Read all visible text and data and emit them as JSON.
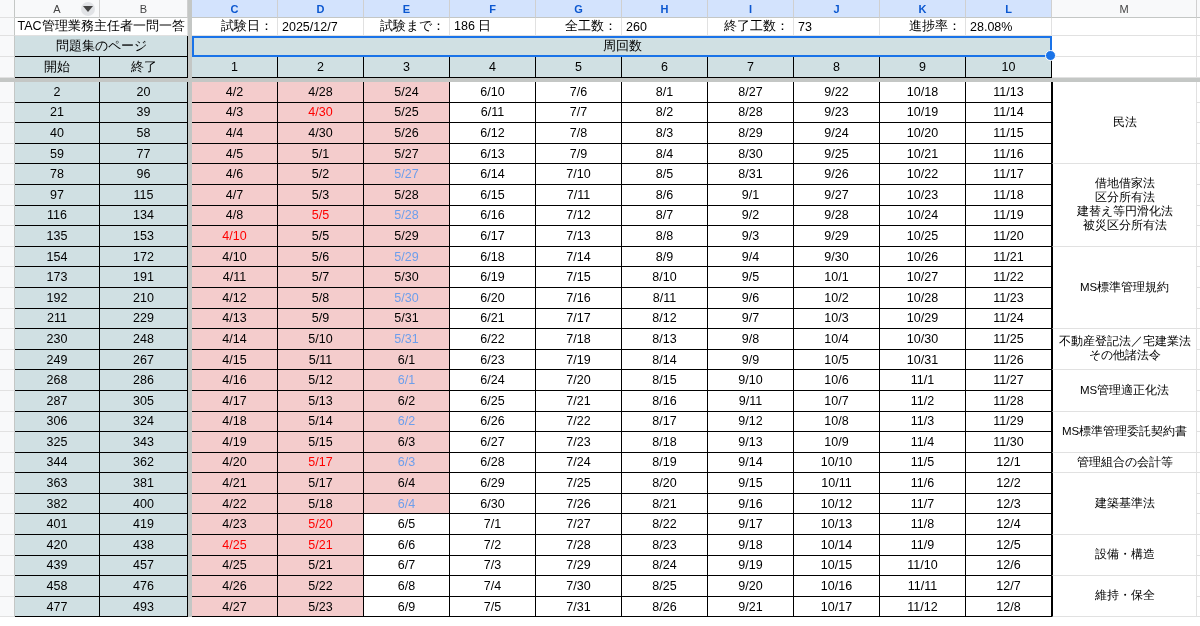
{
  "column_headers": [
    {
      "label": "A",
      "selected": false,
      "filter": true
    },
    {
      "label": "B",
      "selected": false,
      "filter": false
    },
    {
      "label": "C",
      "selected": true,
      "filter": false
    },
    {
      "label": "D",
      "selected": true,
      "filter": false
    },
    {
      "label": "E",
      "selected": true,
      "filter": false
    },
    {
      "label": "F",
      "selected": true,
      "filter": false
    },
    {
      "label": "G",
      "selected": true,
      "filter": false
    },
    {
      "label": "H",
      "selected": true,
      "filter": false
    },
    {
      "label": "I",
      "selected": true,
      "filter": false
    },
    {
      "label": "J",
      "selected": true,
      "filter": false
    },
    {
      "label": "K",
      "selected": true,
      "filter": false
    },
    {
      "label": "L",
      "selected": true,
      "filter": false
    },
    {
      "label": "M",
      "selected": false,
      "filter": false
    }
  ],
  "title": "TAC管理業務主任者一問一答",
  "summary": [
    {
      "label": "試験日：",
      "value": "2025/12/7"
    },
    {
      "label": "試験まで：",
      "value": "186 日"
    },
    {
      "label": "全工数：",
      "value": "260"
    },
    {
      "label": "終了工数：",
      "value": "73"
    },
    {
      "label": "進捗率：",
      "value": "28.08%"
    }
  ],
  "page_header": "問題集のページ",
  "rounds_header": {
    "label": "周回数",
    "selected": true
  },
  "start_label": "開始",
  "end_label": "終了",
  "round_numbers": [
    "1",
    "2",
    "3",
    "4",
    "5",
    "6",
    "7",
    "8",
    "9",
    "10"
  ],
  "sections": [
    {
      "subject": [
        "民法"
      ],
      "rows": [
        {
          "start": "2",
          "end": "20",
          "rounds": [
            {
              "date": "4/2",
              "done": true,
              "color": "#000000"
            },
            {
              "date": "4/28",
              "done": true,
              "color": "#000000"
            },
            {
              "date": "5/24",
              "done": true,
              "color": "#000000"
            },
            {
              "date": "6/10",
              "done": false,
              "color": "#000000"
            },
            {
              "date": "7/6",
              "done": false,
              "color": "#000000"
            },
            {
              "date": "8/1",
              "done": false,
              "color": "#000000"
            },
            {
              "date": "8/27",
              "done": false,
              "color": "#000000"
            },
            {
              "date": "9/22",
              "done": false,
              "color": "#000000"
            },
            {
              "date": "10/18",
              "done": false,
              "color": "#000000"
            },
            {
              "date": "11/13",
              "done": false,
              "color": "#000000"
            }
          ]
        },
        {
          "start": "21",
          "end": "39",
          "rounds": [
            {
              "date": "4/3",
              "done": true,
              "color": "#000000"
            },
            {
              "date": "4/30",
              "done": true,
              "color": "#ff0000"
            },
            {
              "date": "5/25",
              "done": true,
              "color": "#000000"
            },
            {
              "date": "6/11",
              "done": false,
              "color": "#000000"
            },
            {
              "date": "7/7",
              "done": false,
              "color": "#000000"
            },
            {
              "date": "8/2",
              "done": false,
              "color": "#000000"
            },
            {
              "date": "8/28",
              "done": false,
              "color": "#000000"
            },
            {
              "date": "9/23",
              "done": false,
              "color": "#000000"
            },
            {
              "date": "10/19",
              "done": false,
              "color": "#000000"
            },
            {
              "date": "11/14",
              "done": false,
              "color": "#000000"
            }
          ]
        },
        {
          "start": "40",
          "end": "58",
          "rounds": [
            {
              "date": "4/4",
              "done": true,
              "color": "#000000"
            },
            {
              "date": "4/30",
              "done": true,
              "color": "#000000"
            },
            {
              "date": "5/26",
              "done": true,
              "color": "#000000"
            },
            {
              "date": "6/12",
              "done": false,
              "color": "#000000"
            },
            {
              "date": "7/8",
              "done": false,
              "color": "#000000"
            },
            {
              "date": "8/3",
              "done": false,
              "color": "#000000"
            },
            {
              "date": "8/29",
              "done": false,
              "color": "#000000"
            },
            {
              "date": "9/24",
              "done": false,
              "color": "#000000"
            },
            {
              "date": "10/20",
              "done": false,
              "color": "#000000"
            },
            {
              "date": "11/15",
              "done": false,
              "color": "#000000"
            }
          ]
        },
        {
          "start": "59",
          "end": "77",
          "rounds": [
            {
              "date": "4/5",
              "done": true,
              "color": "#000000"
            },
            {
              "date": "5/1",
              "done": true,
              "color": "#000000"
            },
            {
              "date": "5/27",
              "done": true,
              "color": "#000000"
            },
            {
              "date": "6/13",
              "done": false,
              "color": "#000000"
            },
            {
              "date": "7/9",
              "done": false,
              "color": "#000000"
            },
            {
              "date": "8/4",
              "done": false,
              "color": "#000000"
            },
            {
              "date": "8/30",
              "done": false,
              "color": "#000000"
            },
            {
              "date": "9/25",
              "done": false,
              "color": "#000000"
            },
            {
              "date": "10/21",
              "done": false,
              "color": "#000000"
            },
            {
              "date": "11/16",
              "done": false,
              "color": "#000000"
            }
          ]
        }
      ]
    },
    {
      "subject": [
        "借地借家法",
        "区分所有法",
        "建替え等円滑化法",
        "被災区分所有法"
      ],
      "rows": [
        {
          "start": "78",
          "end": "96",
          "rounds": [
            {
              "date": "4/6",
              "done": true,
              "color": "#000000"
            },
            {
              "date": "5/2",
              "done": true,
              "color": "#000000"
            },
            {
              "date": "5/27",
              "done": true,
              "color": "#6d9eeb"
            },
            {
              "date": "6/14",
              "done": false,
              "color": "#000000"
            },
            {
              "date": "7/10",
              "done": false,
              "color": "#000000"
            },
            {
              "date": "8/5",
              "done": false,
              "color": "#000000"
            },
            {
              "date": "8/31",
              "done": false,
              "color": "#000000"
            },
            {
              "date": "9/26",
              "done": false,
              "color": "#000000"
            },
            {
              "date": "10/22",
              "done": false,
              "color": "#000000"
            },
            {
              "date": "11/17",
              "done": false,
              "color": "#000000"
            }
          ]
        },
        {
          "start": "97",
          "end": "115",
          "rounds": [
            {
              "date": "4/7",
              "done": true,
              "color": "#000000"
            },
            {
              "date": "5/3",
              "done": true,
              "color": "#000000"
            },
            {
              "date": "5/28",
              "done": true,
              "color": "#000000"
            },
            {
              "date": "6/15",
              "done": false,
              "color": "#000000"
            },
            {
              "date": "7/11",
              "done": false,
              "color": "#000000"
            },
            {
              "date": "8/6",
              "done": false,
              "color": "#000000"
            },
            {
              "date": "9/1",
              "done": false,
              "color": "#000000"
            },
            {
              "date": "9/27",
              "done": false,
              "color": "#000000"
            },
            {
              "date": "10/23",
              "done": false,
              "color": "#000000"
            },
            {
              "date": "11/18",
              "done": false,
              "color": "#000000"
            }
          ]
        },
        {
          "start": "116",
          "end": "134",
          "rounds": [
            {
              "date": "4/8",
              "done": true,
              "color": "#000000"
            },
            {
              "date": "5/5",
              "done": true,
              "color": "#ff0000"
            },
            {
              "date": "5/28",
              "done": true,
              "color": "#6d9eeb"
            },
            {
              "date": "6/16",
              "done": false,
              "color": "#000000"
            },
            {
              "date": "7/12",
              "done": false,
              "color": "#000000"
            },
            {
              "date": "8/7",
              "done": false,
              "color": "#000000"
            },
            {
              "date": "9/2",
              "done": false,
              "color": "#000000"
            },
            {
              "date": "9/28",
              "done": false,
              "color": "#000000"
            },
            {
              "date": "10/24",
              "done": false,
              "color": "#000000"
            },
            {
              "date": "11/19",
              "done": false,
              "color": "#000000"
            }
          ]
        },
        {
          "start": "135",
          "end": "153",
          "rounds": [
            {
              "date": "4/10",
              "done": true,
              "color": "#ff0000"
            },
            {
              "date": "5/5",
              "done": true,
              "color": "#000000"
            },
            {
              "date": "5/29",
              "done": true,
              "color": "#000000"
            },
            {
              "date": "6/17",
              "done": false,
              "color": "#000000"
            },
            {
              "date": "7/13",
              "done": false,
              "color": "#000000"
            },
            {
              "date": "8/8",
              "done": false,
              "color": "#000000"
            },
            {
              "date": "9/3",
              "done": false,
              "color": "#000000"
            },
            {
              "date": "9/29",
              "done": false,
              "color": "#000000"
            },
            {
              "date": "10/25",
              "done": false,
              "color": "#000000"
            },
            {
              "date": "11/20",
              "done": false,
              "color": "#000000"
            }
          ]
        }
      ]
    },
    {
      "subject": [
        "MS標準管理規約"
      ],
      "rows": [
        {
          "start": "154",
          "end": "172",
          "rounds": [
            {
              "date": "4/10",
              "done": true,
              "color": "#000000"
            },
            {
              "date": "5/6",
              "done": true,
              "color": "#000000"
            },
            {
              "date": "5/29",
              "done": true,
              "color": "#6d9eeb"
            },
            {
              "date": "6/18",
              "done": false,
              "color": "#000000"
            },
            {
              "date": "7/14",
              "done": false,
              "color": "#000000"
            },
            {
              "date": "8/9",
              "done": false,
              "color": "#000000"
            },
            {
              "date": "9/4",
              "done": false,
              "color": "#000000"
            },
            {
              "date": "9/30",
              "done": false,
              "color": "#000000"
            },
            {
              "date": "10/26",
              "done": false,
              "color": "#000000"
            },
            {
              "date": "11/21",
              "done": false,
              "color": "#000000"
            }
          ]
        },
        {
          "start": "173",
          "end": "191",
          "rounds": [
            {
              "date": "4/11",
              "done": true,
              "color": "#000000"
            },
            {
              "date": "5/7",
              "done": true,
              "color": "#000000"
            },
            {
              "date": "5/30",
              "done": true,
              "color": "#000000"
            },
            {
              "date": "6/19",
              "done": false,
              "color": "#000000"
            },
            {
              "date": "7/15",
              "done": false,
              "color": "#000000"
            },
            {
              "date": "8/10",
              "done": false,
              "color": "#000000"
            },
            {
              "date": "9/5",
              "done": false,
              "color": "#000000"
            },
            {
              "date": "10/1",
              "done": false,
              "color": "#000000"
            },
            {
              "date": "10/27",
              "done": false,
              "color": "#000000"
            },
            {
              "date": "11/22",
              "done": false,
              "color": "#000000"
            }
          ]
        },
        {
          "start": "192",
          "end": "210",
          "rounds": [
            {
              "date": "4/12",
              "done": true,
              "color": "#000000"
            },
            {
              "date": "5/8",
              "done": true,
              "color": "#000000"
            },
            {
              "date": "5/30",
              "done": true,
              "color": "#6d9eeb"
            },
            {
              "date": "6/20",
              "done": false,
              "color": "#000000"
            },
            {
              "date": "7/16",
              "done": false,
              "color": "#000000"
            },
            {
              "date": "8/11",
              "done": false,
              "color": "#000000"
            },
            {
              "date": "9/6",
              "done": false,
              "color": "#000000"
            },
            {
              "date": "10/2",
              "done": false,
              "color": "#000000"
            },
            {
              "date": "10/28",
              "done": false,
              "color": "#000000"
            },
            {
              "date": "11/23",
              "done": false,
              "color": "#000000"
            }
          ]
        },
        {
          "start": "211",
          "end": "229",
          "rounds": [
            {
              "date": "4/13",
              "done": true,
              "color": "#000000"
            },
            {
              "date": "5/9",
              "done": true,
              "color": "#000000"
            },
            {
              "date": "5/31",
              "done": true,
              "color": "#000000"
            },
            {
              "date": "6/21",
              "done": false,
              "color": "#000000"
            },
            {
              "date": "7/17",
              "done": false,
              "color": "#000000"
            },
            {
              "date": "8/12",
              "done": false,
              "color": "#000000"
            },
            {
              "date": "9/7",
              "done": false,
              "color": "#000000"
            },
            {
              "date": "10/3",
              "done": false,
              "color": "#000000"
            },
            {
              "date": "10/29",
              "done": false,
              "color": "#000000"
            },
            {
              "date": "11/24",
              "done": false,
              "color": "#000000"
            }
          ]
        }
      ]
    },
    {
      "subject": [
        "不動産登記法／宅建業法",
        "その他諸法令"
      ],
      "rows": [
        {
          "start": "230",
          "end": "248",
          "rounds": [
            {
              "date": "4/14",
              "done": true,
              "color": "#000000"
            },
            {
              "date": "5/10",
              "done": true,
              "color": "#000000"
            },
            {
              "date": "5/31",
              "done": true,
              "color": "#6d9eeb"
            },
            {
              "date": "6/22",
              "done": false,
              "color": "#000000"
            },
            {
              "date": "7/18",
              "done": false,
              "color": "#000000"
            },
            {
              "date": "8/13",
              "done": false,
              "color": "#000000"
            },
            {
              "date": "9/8",
              "done": false,
              "color": "#000000"
            },
            {
              "date": "10/4",
              "done": false,
              "color": "#000000"
            },
            {
              "date": "10/30",
              "done": false,
              "color": "#000000"
            },
            {
              "date": "11/25",
              "done": false,
              "color": "#000000"
            }
          ]
        },
        {
          "start": "249",
          "end": "267",
          "rounds": [
            {
              "date": "4/15",
              "done": true,
              "color": "#000000"
            },
            {
              "date": "5/11",
              "done": true,
              "color": "#000000"
            },
            {
              "date": "6/1",
              "done": true,
              "color": "#000000"
            },
            {
              "date": "6/23",
              "done": false,
              "color": "#000000"
            },
            {
              "date": "7/19",
              "done": false,
              "color": "#000000"
            },
            {
              "date": "8/14",
              "done": false,
              "color": "#000000"
            },
            {
              "date": "9/9",
              "done": false,
              "color": "#000000"
            },
            {
              "date": "10/5",
              "done": false,
              "color": "#000000"
            },
            {
              "date": "10/31",
              "done": false,
              "color": "#000000"
            },
            {
              "date": "11/26",
              "done": false,
              "color": "#000000"
            }
          ]
        }
      ]
    },
    {
      "subject": [
        "MS管理適正化法"
      ],
      "rows": [
        {
          "start": "268",
          "end": "286",
          "rounds": [
            {
              "date": "4/16",
              "done": true,
              "color": "#000000"
            },
            {
              "date": "5/12",
              "done": true,
              "color": "#000000"
            },
            {
              "date": "6/1",
              "done": true,
              "color": "#6d9eeb"
            },
            {
              "date": "6/24",
              "done": false,
              "color": "#000000"
            },
            {
              "date": "7/20",
              "done": false,
              "color": "#000000"
            },
            {
              "date": "8/15",
              "done": false,
              "color": "#000000"
            },
            {
              "date": "9/10",
              "done": false,
              "color": "#000000"
            },
            {
              "date": "10/6",
              "done": false,
              "color": "#000000"
            },
            {
              "date": "11/1",
              "done": false,
              "color": "#000000"
            },
            {
              "date": "11/27",
              "done": false,
              "color": "#000000"
            }
          ]
        },
        {
          "start": "287",
          "end": "305",
          "rounds": [
            {
              "date": "4/17",
              "done": true,
              "color": "#000000"
            },
            {
              "date": "5/13",
              "done": true,
              "color": "#000000"
            },
            {
              "date": "6/2",
              "done": true,
              "color": "#000000"
            },
            {
              "date": "6/25",
              "done": false,
              "color": "#000000"
            },
            {
              "date": "7/21",
              "done": false,
              "color": "#000000"
            },
            {
              "date": "8/16",
              "done": false,
              "color": "#000000"
            },
            {
              "date": "9/11",
              "done": false,
              "color": "#000000"
            },
            {
              "date": "10/7",
              "done": false,
              "color": "#000000"
            },
            {
              "date": "11/2",
              "done": false,
              "color": "#000000"
            },
            {
              "date": "11/28",
              "done": false,
              "color": "#000000"
            }
          ]
        }
      ]
    },
    {
      "subject": [
        "MS標準管理委託契約書"
      ],
      "rows": [
        {
          "start": "306",
          "end": "324",
          "rounds": [
            {
              "date": "4/18",
              "done": true,
              "color": "#000000"
            },
            {
              "date": "5/14",
              "done": true,
              "color": "#000000"
            },
            {
              "date": "6/2",
              "done": true,
              "color": "#6d9eeb"
            },
            {
              "date": "6/26",
              "done": false,
              "color": "#000000"
            },
            {
              "date": "7/22",
              "done": false,
              "color": "#000000"
            },
            {
              "date": "8/17",
              "done": false,
              "color": "#000000"
            },
            {
              "date": "9/12",
              "done": false,
              "color": "#000000"
            },
            {
              "date": "10/8",
              "done": false,
              "color": "#000000"
            },
            {
              "date": "11/3",
              "done": false,
              "color": "#000000"
            },
            {
              "date": "11/29",
              "done": false,
              "color": "#000000"
            }
          ]
        },
        {
          "start": "325",
          "end": "343",
          "rounds": [
            {
              "date": "4/19",
              "done": true,
              "color": "#000000"
            },
            {
              "date": "5/15",
              "done": true,
              "color": "#000000"
            },
            {
              "date": "6/3",
              "done": true,
              "color": "#000000"
            },
            {
              "date": "6/27",
              "done": false,
              "color": "#000000"
            },
            {
              "date": "7/23",
              "done": false,
              "color": "#000000"
            },
            {
              "date": "8/18",
              "done": false,
              "color": "#000000"
            },
            {
              "date": "9/13",
              "done": false,
              "color": "#000000"
            },
            {
              "date": "10/9",
              "done": false,
              "color": "#000000"
            },
            {
              "date": "11/4",
              "done": false,
              "color": "#000000"
            },
            {
              "date": "11/30",
              "done": false,
              "color": "#000000"
            }
          ]
        }
      ]
    },
    {
      "subject": [
        "管理組合の会計等"
      ],
      "rows": [
        {
          "start": "344",
          "end": "362",
          "rounds": [
            {
              "date": "4/20",
              "done": true,
              "color": "#000000"
            },
            {
              "date": "5/17",
              "done": true,
              "color": "#ff0000"
            },
            {
              "date": "6/3",
              "done": true,
              "color": "#6d9eeb"
            },
            {
              "date": "6/28",
              "done": false,
              "color": "#000000"
            },
            {
              "date": "7/24",
              "done": false,
              "color": "#000000"
            },
            {
              "date": "8/19",
              "done": false,
              "color": "#000000"
            },
            {
              "date": "9/14",
              "done": false,
              "color": "#000000"
            },
            {
              "date": "10/10",
              "done": false,
              "color": "#000000"
            },
            {
              "date": "11/5",
              "done": false,
              "color": "#000000"
            },
            {
              "date": "12/1",
              "done": false,
              "color": "#000000"
            }
          ]
        }
      ]
    },
    {
      "subject": [
        "建築基準法"
      ],
      "rows": [
        {
          "start": "363",
          "end": "381",
          "rounds": [
            {
              "date": "4/21",
              "done": true,
              "color": "#000000"
            },
            {
              "date": "5/17",
              "done": true,
              "color": "#000000"
            },
            {
              "date": "6/4",
              "done": true,
              "color": "#000000"
            },
            {
              "date": "6/29",
              "done": false,
              "color": "#000000"
            },
            {
              "date": "7/25",
              "done": false,
              "color": "#000000"
            },
            {
              "date": "8/20",
              "done": false,
              "color": "#000000"
            },
            {
              "date": "9/15",
              "done": false,
              "color": "#000000"
            },
            {
              "date": "10/11",
              "done": false,
              "color": "#000000"
            },
            {
              "date": "11/6",
              "done": false,
              "color": "#000000"
            },
            {
              "date": "12/2",
              "done": false,
              "color": "#000000"
            }
          ]
        },
        {
          "start": "382",
          "end": "400",
          "rounds": [
            {
              "date": "4/22",
              "done": true,
              "color": "#000000"
            },
            {
              "date": "5/18",
              "done": true,
              "color": "#000000"
            },
            {
              "date": "6/4",
              "done": true,
              "color": "#6d9eeb"
            },
            {
              "date": "6/30",
              "done": false,
              "color": "#000000"
            },
            {
              "date": "7/26",
              "done": false,
              "color": "#000000"
            },
            {
              "date": "8/21",
              "done": false,
              "color": "#000000"
            },
            {
              "date": "9/16",
              "done": false,
              "color": "#000000"
            },
            {
              "date": "10/12",
              "done": false,
              "color": "#000000"
            },
            {
              "date": "11/7",
              "done": false,
              "color": "#000000"
            },
            {
              "date": "12/3",
              "done": false,
              "color": "#000000"
            }
          ]
        },
        {
          "start": "401",
          "end": "419",
          "rounds": [
            {
              "date": "4/23",
              "done": true,
              "color": "#000000"
            },
            {
              "date": "5/20",
              "done": true,
              "color": "#ff0000"
            },
            {
              "date": "6/5",
              "done": false,
              "color": "#000000"
            },
            {
              "date": "7/1",
              "done": false,
              "color": "#000000"
            },
            {
              "date": "7/27",
              "done": false,
              "color": "#000000"
            },
            {
              "date": "8/22",
              "done": false,
              "color": "#000000"
            },
            {
              "date": "9/17",
              "done": false,
              "color": "#000000"
            },
            {
              "date": "10/13",
              "done": false,
              "color": "#000000"
            },
            {
              "date": "11/8",
              "done": false,
              "color": "#000000"
            },
            {
              "date": "12/4",
              "done": false,
              "color": "#000000"
            }
          ]
        }
      ]
    },
    {
      "subject": [
        "設備・構造"
      ],
      "rows": [
        {
          "start": "420",
          "end": "438",
          "rounds": [
            {
              "date": "4/25",
              "done": true,
              "color": "#ff0000"
            },
            {
              "date": "5/21",
              "done": true,
              "color": "#ff0000"
            },
            {
              "date": "6/6",
              "done": false,
              "color": "#000000"
            },
            {
              "date": "7/2",
              "done": false,
              "color": "#000000"
            },
            {
              "date": "7/28",
              "done": false,
              "color": "#000000"
            },
            {
              "date": "8/23",
              "done": false,
              "color": "#000000"
            },
            {
              "date": "9/18",
              "done": false,
              "color": "#000000"
            },
            {
              "date": "10/14",
              "done": false,
              "color": "#000000"
            },
            {
              "date": "11/9",
              "done": false,
              "color": "#000000"
            },
            {
              "date": "12/5",
              "done": false,
              "color": "#000000"
            }
          ]
        },
        {
          "start": "439",
          "end": "457",
          "rounds": [
            {
              "date": "4/25",
              "done": true,
              "color": "#000000"
            },
            {
              "date": "5/21",
              "done": true,
              "color": "#000000"
            },
            {
              "date": "6/7",
              "done": false,
              "color": "#000000"
            },
            {
              "date": "7/3",
              "done": false,
              "color": "#000000"
            },
            {
              "date": "7/29",
              "done": false,
              "color": "#000000"
            },
            {
              "date": "8/24",
              "done": false,
              "color": "#000000"
            },
            {
              "date": "9/19",
              "done": false,
              "color": "#000000"
            },
            {
              "date": "10/15",
              "done": false,
              "color": "#000000"
            },
            {
              "date": "11/10",
              "done": false,
              "color": "#000000"
            },
            {
              "date": "12/6",
              "done": false,
              "color": "#000000"
            }
          ]
        }
      ]
    },
    {
      "subject": [
        "維持・保全"
      ],
      "rows": [
        {
          "start": "458",
          "end": "476",
          "rounds": [
            {
              "date": "4/26",
              "done": true,
              "color": "#000000"
            },
            {
              "date": "5/22",
              "done": true,
              "color": "#000000"
            },
            {
              "date": "6/8",
              "done": false,
              "color": "#000000"
            },
            {
              "date": "7/4",
              "done": false,
              "color": "#000000"
            },
            {
              "date": "7/30",
              "done": false,
              "color": "#000000"
            },
            {
              "date": "8/25",
              "done": false,
              "color": "#000000"
            },
            {
              "date": "9/20",
              "done": false,
              "color": "#000000"
            },
            {
              "date": "10/16",
              "done": false,
              "color": "#000000"
            },
            {
              "date": "11/11",
              "done": false,
              "color": "#000000"
            },
            {
              "date": "12/7",
              "done": false,
              "color": "#000000"
            }
          ]
        },
        {
          "start": "477",
          "end": "493",
          "rounds": [
            {
              "date": "4/27",
              "done": true,
              "color": "#000000"
            },
            {
              "date": "5/23",
              "done": true,
              "color": "#000000"
            },
            {
              "date": "6/9",
              "done": false,
              "color": "#000000"
            },
            {
              "date": "7/5",
              "done": false,
              "color": "#000000"
            },
            {
              "date": "7/31",
              "done": false,
              "color": "#000000"
            },
            {
              "date": "8/26",
              "done": false,
              "color": "#000000"
            },
            {
              "date": "9/21",
              "done": false,
              "color": "#000000"
            },
            {
              "date": "10/17",
              "done": false,
              "color": "#000000"
            },
            {
              "date": "11/12",
              "done": false,
              "color": "#000000"
            },
            {
              "date": "12/8",
              "done": false,
              "color": "#000000"
            }
          ]
        }
      ]
    }
  ]
}
